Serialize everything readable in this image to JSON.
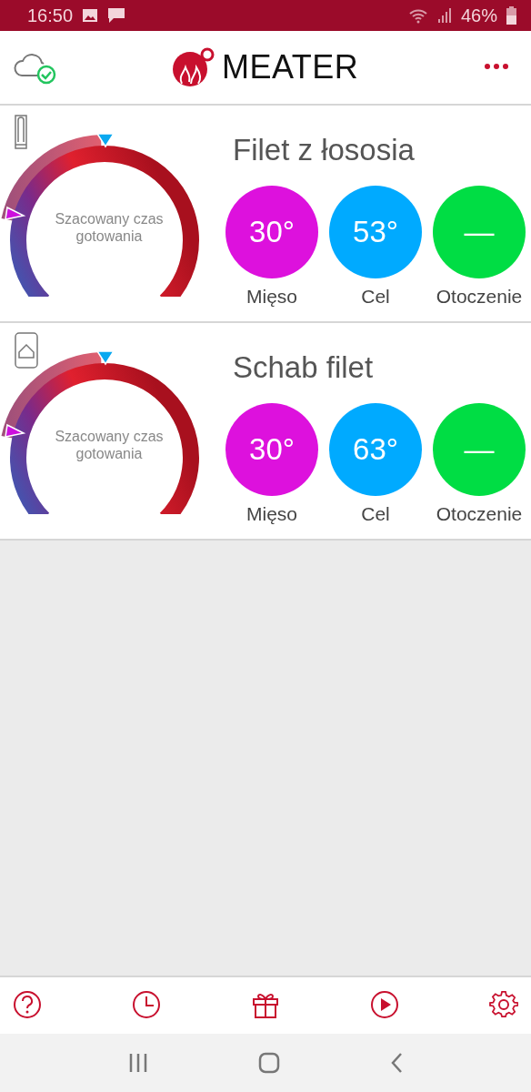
{
  "status_bar": {
    "time": "16:50",
    "battery": "46%"
  },
  "header": {
    "logo": "MEATER"
  },
  "probes": [
    {
      "kind": "probe",
      "center_label": "Szacowany czas gotowania",
      "name": "Filet z łososia",
      "readings": [
        {
          "value": "30°",
          "label": "Mięso",
          "color": "#dd11dd"
        },
        {
          "value": "53°",
          "label": "Cel",
          "color": "#00aaff"
        },
        {
          "value": "—",
          "label": "Otoczenie",
          "color": "#00dd44"
        }
      ]
    },
    {
      "kind": "block",
      "center_label": "Szacowany czas gotowania",
      "name": "Schab filet",
      "readings": [
        {
          "value": "30°",
          "label": "Mięso",
          "color": "#dd11dd"
        },
        {
          "value": "63°",
          "label": "Cel",
          "color": "#00aaff"
        },
        {
          "value": "—",
          "label": "Otoczenie",
          "color": "#00dd44"
        }
      ]
    }
  ],
  "bottom_nav": [
    {
      "kind": "help"
    },
    {
      "kind": "history"
    },
    {
      "kind": "gift"
    },
    {
      "kind": "video"
    },
    {
      "kind": "settings"
    }
  ]
}
